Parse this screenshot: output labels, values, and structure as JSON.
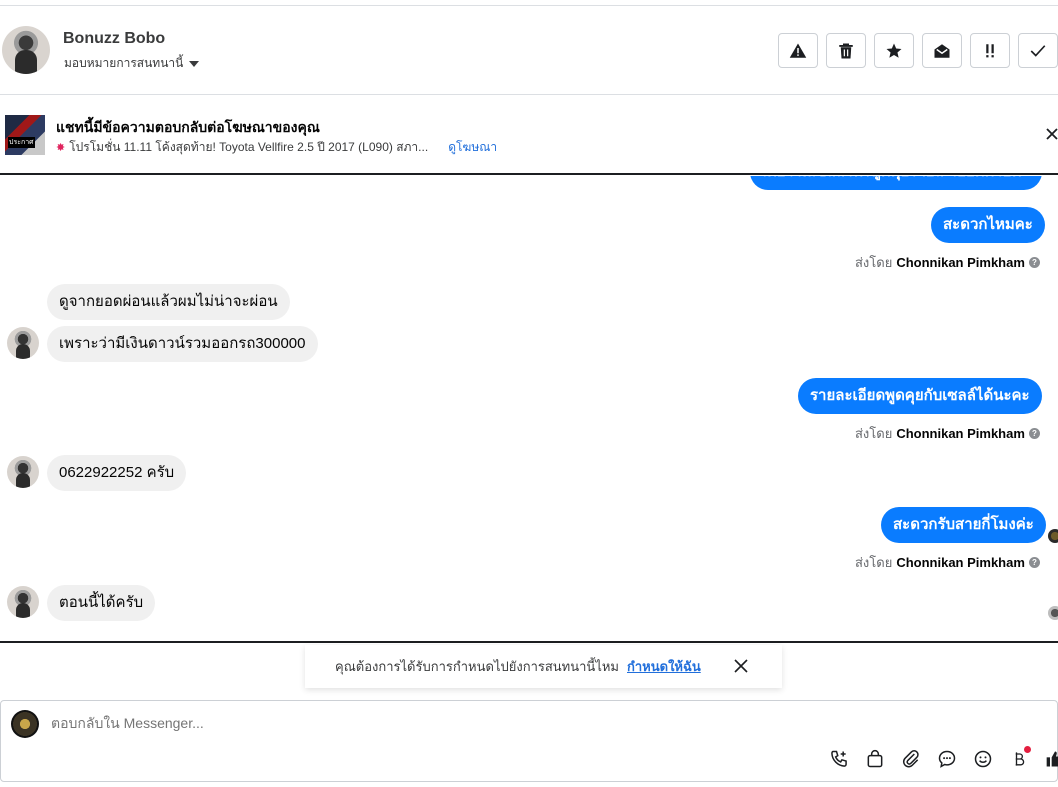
{
  "header": {
    "user_name": "Bonuzz Bobo",
    "assign_label": "มอบหมายการสนทนานี้",
    "actions": [
      "warning-icon",
      "trash-icon",
      "star-icon",
      "mark-unread-icon",
      "follow-up-icon",
      "done-icon"
    ]
  },
  "ad": {
    "thumb_text": "ประกาศ",
    "title": "แชทนี้มีข้อความตอบกลับต่อโฆษณาของคุณ",
    "subtitle": "โปรโมชั่น 11.11 โค้งสุดท้าย! Toyota Vellfire 2.5 ปี 2017 (L090) สภา...",
    "link": "ดูโฆษณา"
  },
  "messages": {
    "m0": "เดี๋ยวให้เซลล์โทรพูดคุยรายละเอียดด้วยค่ะ",
    "m1": "สะดวกไหมคะ",
    "sent_by_prefix": "ส่งโดย",
    "agent": "Chonnikan Pimkham",
    "m2": "ดูจากยอดผ่อนแล้วผมไม่น่าจะผ่อน",
    "m3": "เพราะว่ามีเงินดาวน์รวมออกรถ300000",
    "m4": "รายละเอียดพูดคุยกับเซลล์ได้นะคะ",
    "m5": "0622922252 ครับ",
    "m6": "สะดวกรับสายกี่โมงค่ะ",
    "m7": "ตอนนี้ได้ครับ"
  },
  "prompt": {
    "text": "คุณต้องการได้รับการกำหนดไปยังการสนทนานี้ไหม",
    "link": "กำหนดให้ฉัน"
  },
  "reply": {
    "placeholder": "ตอบกลับใน Messenger..."
  },
  "colors": {
    "outgoing": "#0a7cff",
    "incoming": "#f0f0f0",
    "link": "#216fdb"
  }
}
